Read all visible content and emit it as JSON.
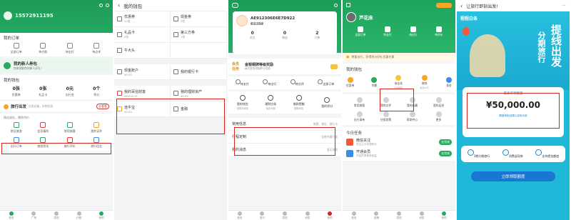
{
  "p1": {
    "phone": "15572911195",
    "orders_title": "我的订单",
    "order_items": [
      "全部订单",
      "待付款",
      "待出行",
      "待点评"
    ],
    "banner_title": "我的新人券包",
    "banner_sub": "快来领取你的新人好礼！",
    "wallet_title": "我的钱包",
    "wallet": [
      {
        "value": "0张",
        "label": "优惠券"
      },
      {
        "value": "0张",
        "label": "礼品卡"
      },
      {
        "value": "0元",
        "label": "出行金"
      },
      {
        "value": "0个",
        "label": "积分"
      }
    ],
    "travel_title": "旅行出发",
    "travel_sub": "出发必备，好物优选",
    "travel_btn": "去看看",
    "grid_note": "精选服务，爆款特价",
    "services": [
      "常见旅游",
      "会员福利",
      "常用旅客",
      "我的证件",
      "出行订单",
      "旅游资讯",
      "旅行评价",
      "旅行回忆"
    ],
    "nav": [
      "首页",
      "广场",
      "发现",
      "行程",
      "我的"
    ]
  },
  "p2": {
    "title": "我的钱包",
    "cells": [
      {
        "t": "优惠券",
        "s": "12张"
      },
      {
        "t": "现金券",
        "s": "3张"
      },
      {
        "t": "礼品卡",
        "s": "0张"
      },
      {
        "t": "第三方券",
        "s": "1张"
      },
      {
        "t": "牛大头",
        "s": ""
      },
      {
        "t": "",
        "s": ""
      },
      {
        "t": "现金账户",
        "s": "¥0.00"
      },
      {
        "t": "我的银行卡",
        "s": ""
      },
      {
        "t": "我的百信财富",
        "s": "¥6000.00"
      },
      {
        "t": "我的理财资产",
        "s": "¥0.00"
      },
      {
        "t": "途牛宝",
        "s": "¥0.00"
      },
      {
        "t": "金融",
        "s": ""
      }
    ]
  },
  "p3": {
    "id": "AE912306E6E7D922",
    "badge": "普通会员",
    "stats": [
      {
        "v": "0",
        "l": "关注"
      },
      {
        "v": "0",
        "l": "粉丝"
      },
      {
        "v": "2",
        "l": "订单"
      }
    ],
    "gold_tag": "会员任务",
    "gold_title": "金银铜牌等级奖励",
    "gold_sub": "每天签到领取积分奖励",
    "quick": [
      "待支付",
      "待出行",
      "待点评",
      "全部订单"
    ],
    "finance": [
      {
        "t": "我的钱包",
        "s": "领券享优惠"
      },
      {
        "t": "理财白条",
        "s": "免息分期"
      },
      {
        "t": "借款提额",
        "s": "提额申请"
      },
      {
        "t": "我的积分",
        "s": ""
      }
    ],
    "list": [
      {
        "t": "常用信息",
        "s": "旅客、地址、银行卡"
      },
      {
        "t": "行程定制",
        "s": "定制专属行程"
      },
      {
        "t": "我的消息",
        "s": "暂无消息"
      }
    ],
    "nav": [
      "首页",
      "旅行",
      "发现",
      "消息",
      "我的"
    ]
  },
  "p4": {
    "name": "芦花床",
    "tiles": [
      "全部订单",
      "待支付",
      "待出行",
      "待评价"
    ],
    "notice": "将要出行，获得积分好礼优惠兑换",
    "wallet_title": "我的钱包",
    "wallet": [
      {
        "t": "优惠券",
        "s": ""
      },
      {
        "t": "余额",
        "s": ""
      },
      {
        "t": "拿去花",
        "s": "可用额度"
      },
      {
        "t": "借钱",
        "s": "最高20万"
      },
      {
        "t": "现金",
        "s": ""
      }
    ],
    "tools": [
      "常用旅客",
      "我的点评",
      "我的收藏",
      "我的足迹",
      "出行清单",
      "住宿发票",
      "帮助中心",
      "更多"
    ],
    "tasks_title": "今日任务",
    "tasks": [
      {
        "t": "微信关注",
        "s": "关注公众号领积分",
        "b": "去完成"
      },
      {
        "t": "开通会员",
        "s": "开会员享更多权益",
        "b": "去完成"
      }
    ],
    "nav": [
      "首页",
      "攻略",
      "发现",
      "消息",
      "我的"
    ]
  },
  "p5": {
    "title": "让旅行即刻出发!",
    "logo": "程程白条",
    "slogan1": "提线出发",
    "slogan2": "分期旅行",
    "limit_label": "最高可领额度",
    "amount": "¥50,000.00",
    "note": "额度审批结果以实际为准",
    "features": [
      {
        "t": "3期分期旅行"
      },
      {
        "t": "消费返现券"
      },
      {
        "t": "支持提金额度"
      }
    ],
    "cta": "立即领取额度"
  }
}
